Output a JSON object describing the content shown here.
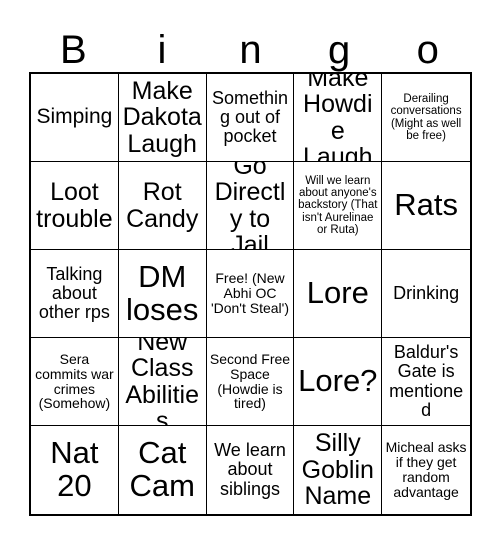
{
  "card": {
    "title_letters": [
      "B",
      "i",
      "n",
      "g",
      "o"
    ]
  },
  "grid": {
    "columns": 5,
    "rows": 5,
    "cells": [
      {
        "text": "Simping",
        "size": "lg"
      },
      {
        "text": "Make Dakota Laugh",
        "size": "xl"
      },
      {
        "text": "Something out of pocket",
        "size": "md"
      },
      {
        "text": "Make Howdie Laugh",
        "size": "xl"
      },
      {
        "text": "Derailing conversations (Might as well be free)",
        "size": "xs"
      },
      {
        "text": "Loot trouble",
        "size": "xl"
      },
      {
        "text": "Rot Candy",
        "size": "xl"
      },
      {
        "text": "Go Directly to Jail",
        "size": "xl"
      },
      {
        "text": "Will we learn about anyone's backstory (That isn't Aurelinae or Ruta)",
        "size": "xs"
      },
      {
        "text": "Rats",
        "size": "xxl"
      },
      {
        "text": "Talking about other rps",
        "size": "md"
      },
      {
        "text": "DM loses",
        "size": "xxl"
      },
      {
        "text": "Free! (New Abhi OC 'Don't Steal')",
        "size": "sm"
      },
      {
        "text": "Lore",
        "size": "xxl"
      },
      {
        "text": "Drinking",
        "size": "md"
      },
      {
        "text": "Sera commits war crimes (Somehow)",
        "size": "sm"
      },
      {
        "text": "New Class Abilities",
        "size": "xl"
      },
      {
        "text": "Second Free Space (Howdie is tired)",
        "size": "sm"
      },
      {
        "text": "Lore?",
        "size": "xxl"
      },
      {
        "text": "Baldur's Gate is mentioned",
        "size": "md"
      },
      {
        "text": "Nat 20",
        "size": "xxl"
      },
      {
        "text": "Cat Cam",
        "size": "xxl"
      },
      {
        "text": "We learn about siblings",
        "size": "md"
      },
      {
        "text": "Silly Goblin Name",
        "size": "xl"
      },
      {
        "text": "Micheal asks if they get random advantage",
        "size": "sm"
      }
    ]
  },
  "colors": {
    "background": "#ffffff",
    "text": "#000000",
    "grid_line": "#000000"
  }
}
